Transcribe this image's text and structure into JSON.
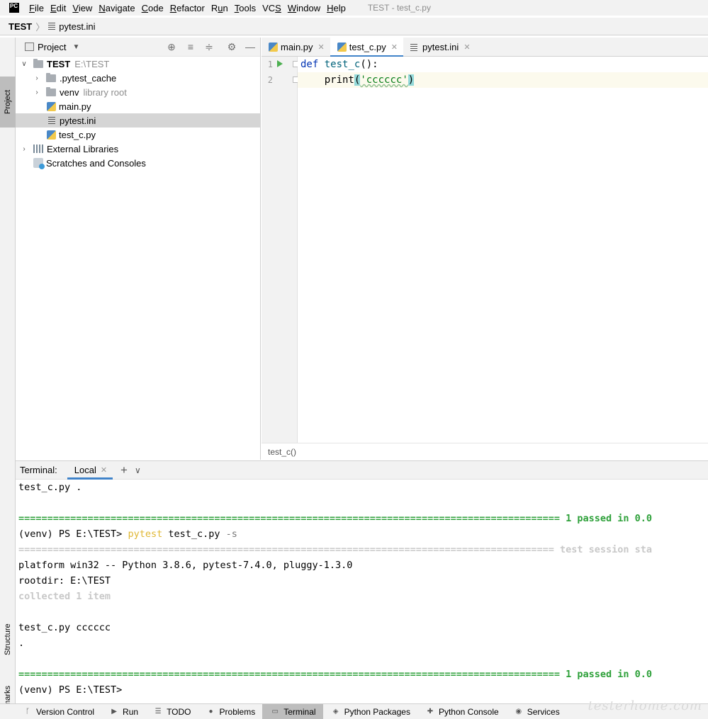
{
  "menubar": {
    "logo": "PC",
    "items": [
      {
        "pre": "",
        "u": "F",
        "post": "ile"
      },
      {
        "pre": "",
        "u": "E",
        "post": "dit"
      },
      {
        "pre": "",
        "u": "V",
        "post": "iew"
      },
      {
        "pre": "",
        "u": "N",
        "post": "avigate"
      },
      {
        "pre": "",
        "u": "C",
        "post": "ode"
      },
      {
        "pre": "",
        "u": "R",
        "post": "efactor"
      },
      {
        "pre": "R",
        "u": "u",
        "post": "n"
      },
      {
        "pre": "",
        "u": "T",
        "post": "ools"
      },
      {
        "pre": "VC",
        "u": "S",
        "post": ""
      },
      {
        "pre": "",
        "u": "W",
        "post": "indow"
      },
      {
        "pre": "",
        "u": "H",
        "post": "elp"
      }
    ],
    "window_title": "TEST - test_c.py"
  },
  "breadcrumb": {
    "root": "TEST",
    "file": "pytest.ini"
  },
  "left_strip": {
    "project": "Project",
    "structure": "Structure",
    "bookmarks": "Bookmarks"
  },
  "project": {
    "title": "Project",
    "tree": {
      "root_name": "TEST",
      "root_path": "E:\\TEST",
      "pytest_cache": ".pytest_cache",
      "venv": "venv",
      "venv_note": "library root",
      "main": "main.py",
      "pytest_ini": "pytest.ini",
      "test_c": "test_c.py",
      "external": "External Libraries",
      "scratches": "Scratches and Consoles"
    }
  },
  "editor": {
    "tabs": [
      "main.py",
      "test_c.py",
      "pytest.ini"
    ],
    "line_numbers": [
      "1",
      "2"
    ],
    "code": {
      "def_kw": "def",
      "fn_name": "test_c",
      "sig_rest": "():",
      "print": "print",
      "open": "(",
      "string": "'cccccc'",
      "close": ")"
    },
    "crumb": "test_c()"
  },
  "terminal": {
    "label": "Terminal:",
    "tab": "Local",
    "lines": {
      "l1": "test_c.py .",
      "sep1": "============================================================================================== ",
      "passed1": "1 passed in 0.0",
      "prompt1": "(venv) PS E:\\TEST> ",
      "cmd": "pytest",
      "args": " test_c.py ",
      "flag": "-s",
      "session": "============================================================================================= test session sta",
      "platform": "platform win32 -- Python 3.8.6, pytest-7.4.0, pluggy-1.3.0",
      "rootdir": "rootdir: E:\\TEST",
      "collected": "collected 1 item",
      "output": "test_c.py cccccc",
      "dot": ".",
      "sep2": "============================================================================================== ",
      "passed2": "1 passed in 0.0",
      "prompt2": "(venv) PS E:\\TEST>"
    }
  },
  "bottom_bar": [
    {
      "label": "Version Control",
      "icon": "branch-icon"
    },
    {
      "label": "Run",
      "icon": "run-icon"
    },
    {
      "label": "TODO",
      "icon": "list-icon"
    },
    {
      "label": "Problems",
      "icon": "problems-icon"
    },
    {
      "label": "Terminal",
      "icon": "terminal-icon"
    },
    {
      "label": "Python Packages",
      "icon": "packages-icon"
    },
    {
      "label": "Python Console",
      "icon": "python-icon"
    },
    {
      "label": "Services",
      "icon": "services-icon"
    }
  ],
  "watermark": "testerhome.com"
}
